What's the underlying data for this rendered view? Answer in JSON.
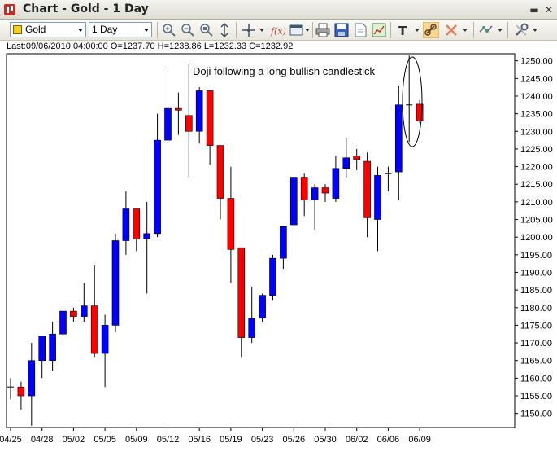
{
  "window": {
    "title": "Chart - Gold - 1 Day",
    "minimize_glyph": "▬",
    "restore_glyph": "❐",
    "close_glyph": "✕"
  },
  "toolbar": {
    "symbol_value": "Gold",
    "interval_value": "1 Day",
    "icons": [
      "zoom-in-icon",
      "zoom-out-icon",
      "zoom-reset-icon",
      "scale-icon",
      "crosshair-icon",
      "function-icon",
      "window-icon",
      "print-icon",
      "save-icon",
      "document-icon",
      "export-chart-icon",
      "text-tool-icon",
      "link-icon",
      "delete-icon",
      "indicator-icon",
      "settings-icon"
    ]
  },
  "info_line": "Last:09/06/2010 04:00:00 O=1237.70 H=1238.86 L=1232.33 C=1232.92",
  "annotation": "Doji following a long bullish candlestick",
  "colors": {
    "bullish": "#0000ff",
    "bearish": "#ff0000",
    "wick": "#000000",
    "doji": "#000000"
  },
  "chart_data": {
    "type": "candlestick",
    "x_tick_labels": [
      "04/25",
      "04/28",
      "05/02",
      "05/05",
      "05/09",
      "05/12",
      "05/16",
      "05/19",
      "05/23",
      "05/26",
      "05/30",
      "06/02",
      "06/06",
      "06/09"
    ],
    "y_tick_labels": [
      "1250.00",
      "1245.00",
      "1240.00",
      "1235.00",
      "1230.00",
      "1225.00",
      "1220.00",
      "1215.00",
      "1210.00",
      "1205.00",
      "1200.00",
      "1195.00",
      "1190.00",
      "1185.00",
      "1180.00",
      "1175.00",
      "1170.00",
      "1165.00",
      "1160.00",
      "1155.00",
      "1150.00"
    ],
    "ylim": [
      1146,
      1252
    ],
    "candles": [
      {
        "o": 1157.5,
        "h": 1160.0,
        "l": 1154.0,
        "c": 1157.5
      },
      {
        "o": 1157.5,
        "h": 1159.0,
        "l": 1151.0,
        "c": 1155.0
      },
      {
        "o": 1155.0,
        "h": 1170.0,
        "l": 1146.5,
        "c": 1165.0
      },
      {
        "o": 1165.0,
        "h": 1172.0,
        "l": 1160.0,
        "c": 1172.0
      },
      {
        "o": 1165.0,
        "h": 1176.0,
        "l": 1162.0,
        "c": 1172.5
      },
      {
        "o": 1172.5,
        "h": 1180.0,
        "l": 1170.0,
        "c": 1179.0
      },
      {
        "o": 1179.0,
        "h": 1180.0,
        "l": 1176.0,
        "c": 1177.5
      },
      {
        "o": 1177.5,
        "h": 1187.0,
        "l": 1176.0,
        "c": 1180.5
      },
      {
        "o": 1180.5,
        "h": 1192.0,
        "l": 1166.0,
        "c": 1167.0
      },
      {
        "o": 1167.0,
        "h": 1178.0,
        "l": 1157.5,
        "c": 1175.0
      },
      {
        "o": 1175.0,
        "h": 1201.0,
        "l": 1173.0,
        "c": 1199.0
      },
      {
        "o": 1199.0,
        "h": 1213.0,
        "l": 1195.0,
        "c": 1208.0
      },
      {
        "o": 1208.0,
        "h": 1208.0,
        "l": 1196.0,
        "c": 1199.5
      },
      {
        "o": 1199.5,
        "h": 1210.0,
        "l": 1184.0,
        "c": 1201.0
      },
      {
        "o": 1201.0,
        "h": 1235.0,
        "l": 1200.0,
        "c": 1227.5
      },
      {
        "o": 1227.5,
        "h": 1248.5,
        "l": 1227.0,
        "c": 1236.5
      },
      {
        "o": 1236.5,
        "h": 1241.0,
        "l": 1229.0,
        "c": 1236.0
      },
      {
        "o": 1234.5,
        "h": 1249.0,
        "l": 1217.0,
        "c": 1230.0
      },
      {
        "o": 1230.0,
        "h": 1242.5,
        "l": 1226.5,
        "c": 1241.5
      },
      {
        "o": 1241.5,
        "h": 1241.5,
        "l": 1220.5,
        "c": 1226.0
      },
      {
        "o": 1226.0,
        "h": 1226.0,
        "l": 1205.0,
        "c": 1211.0
      },
      {
        "o": 1211.0,
        "h": 1220.0,
        "l": 1187.0,
        "c": 1196.5
      },
      {
        "o": 1197.0,
        "h": 1197.0,
        "l": 1166.0,
        "c": 1171.5
      },
      {
        "o": 1171.5,
        "h": 1186.0,
        "l": 1170.0,
        "c": 1177.0
      },
      {
        "o": 1177.0,
        "h": 1184.0,
        "l": 1176.0,
        "c": 1183.5
      },
      {
        "o": 1183.5,
        "h": 1195.0,
        "l": 1182.0,
        "c": 1194.0
      },
      {
        "o": 1194.0,
        "h": 1203.0,
        "l": 1191.0,
        "c": 1203.0
      },
      {
        "o": 1203.5,
        "h": 1217.0,
        "l": 1203.0,
        "c": 1217.0
      },
      {
        "o": 1217.0,
        "h": 1218.0,
        "l": 1206.0,
        "c": 1210.5
      },
      {
        "o": 1210.5,
        "h": 1215.0,
        "l": 1202.0,
        "c": 1214.0
      },
      {
        "o": 1214.0,
        "h": 1215.0,
        "l": 1210.0,
        "c": 1212.5
      },
      {
        "o": 1211.0,
        "h": 1223.0,
        "l": 1210.0,
        "c": 1219.5
      },
      {
        "o": 1219.5,
        "h": 1228.0,
        "l": 1217.0,
        "c": 1222.5
      },
      {
        "o": 1223.0,
        "h": 1225.0,
        "l": 1219.0,
        "c": 1222.0
      },
      {
        "o": 1221.5,
        "h": 1224.0,
        "l": 1200.0,
        "c": 1205.5
      },
      {
        "o": 1205.0,
        "h": 1220.0,
        "l": 1196.0,
        "c": 1217.5
      },
      {
        "o": 1218.0,
        "h": 1220.0,
        "l": 1213.0,
        "c": 1218.0
      },
      {
        "o": 1218.5,
        "h": 1243.0,
        "l": 1210.5,
        "c": 1237.5
      },
      {
        "o": 1237.5,
        "h": 1251.5,
        "l": 1227.0,
        "c": 1237.5
      },
      {
        "o": 1237.7,
        "h": 1238.86,
        "l": 1232.33,
        "c": 1232.92
      }
    ]
  }
}
